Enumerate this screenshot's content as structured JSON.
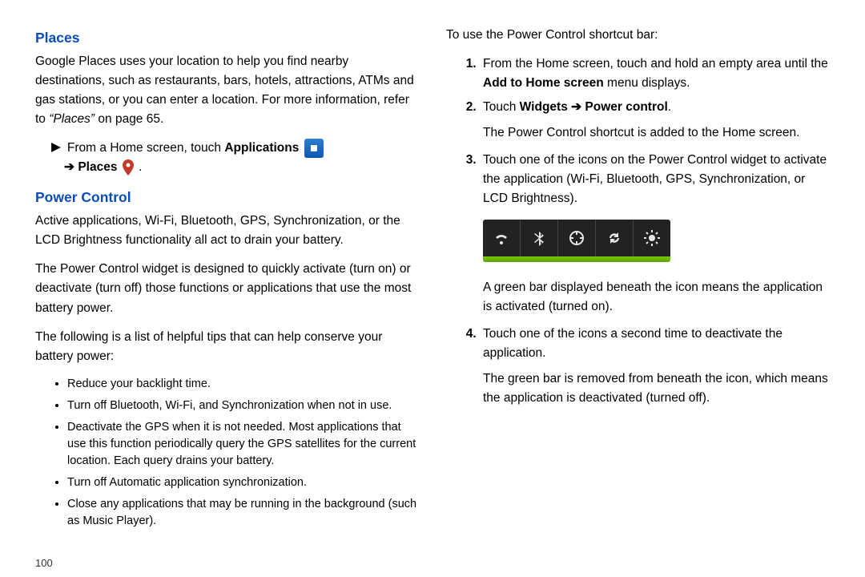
{
  "page_number": "100",
  "left": {
    "h1": "Places",
    "p1_a": "Google Places uses your location to help you find nearby destinations, such as restaurants, bars, hotels, attractions, ATMs and gas stations, or you can enter a location. For more information, refer to ",
    "p1_em": "“Places”",
    "p1_b": " on page 65.",
    "step_prefix": "From a Home screen, touch ",
    "step_bold1": "Applications",
    "step_arrow": "➔",
    "step_bold2": "Places",
    "h2": "Power Control",
    "p2": "Active applications, Wi-Fi, Bluetooth, GPS, Synchronization, or the LCD Brightness functionality all act to drain your battery.",
    "p3": "The Power Control widget is designed to quickly activate (turn on) or deactivate (turn off) those functions or applications that use the most battery power.",
    "p4": "The following is a list of helpful tips that can help conserve your battery power:",
    "bullets": [
      "Reduce your backlight time.",
      "Turn off Bluetooth, Wi-Fi, and Synchronization when not in use.",
      "Deactivate the GPS when it is not needed. Most applications that use this function periodically query the GPS satellites for the current location. Each query drains your battery.",
      "Turn off Automatic application synchronization.",
      "Close any applications that may be running in the background (such as Music Player)."
    ]
  },
  "right": {
    "intro": "To use the Power Control shortcut bar:",
    "li1_a": "From the Home screen, touch and hold an empty area until the ",
    "li1_bold": "Add to Home screen",
    "li1_b": " menu displays.",
    "li2_a": "Touch ",
    "li2_bold1": "Widgets",
    "li2_arrow": " ➔ ",
    "li2_bold2": "Power control",
    "li2_b": ".",
    "li2_p": "The Power Control shortcut is added to the Home screen.",
    "li3_p": "Touch one of the icons on the Power Control widget to activate the application (Wi-Fi, Bluetooth, GPS, Synchronization, or LCD Brightness).",
    "li3_after": "A green bar displayed beneath the icon means the application is activated (turned on).",
    "li4_p": "Touch one of the icons a second time to deactivate the application.",
    "li4_after": "The green bar is removed from beneath the icon, which means the application is deactivated (turned off).",
    "widget_icons": [
      "wifi",
      "bluetooth",
      "gps",
      "sync",
      "brightness"
    ]
  }
}
